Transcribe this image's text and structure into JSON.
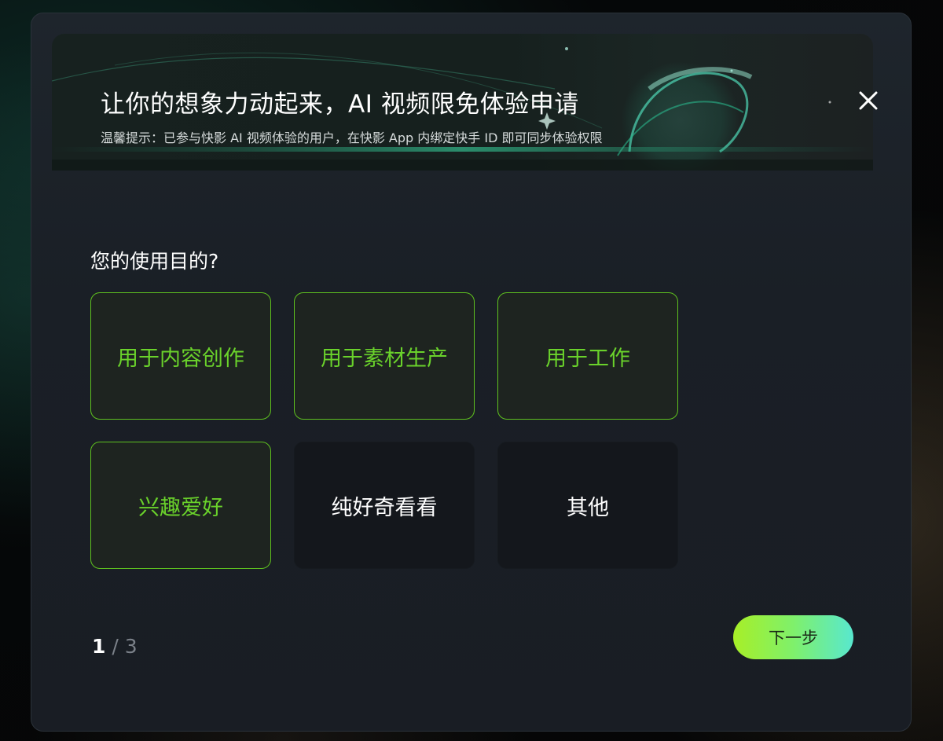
{
  "banner": {
    "title": "让你的想象力动起来，AI 视频限免体验申请",
    "tip": "温馨提示：已参与快影 AI 视频体验的用户，在快影 App 内绑定快手 ID 即可同步体验权限"
  },
  "question": "您的使用目的?",
  "options": [
    {
      "label": "用于内容创作",
      "selected": true
    },
    {
      "label": "用于素材生产",
      "selected": true
    },
    {
      "label": "用于工作",
      "selected": true
    },
    {
      "label": "兴趣爱好",
      "selected": true
    },
    {
      "label": "纯好奇看看",
      "selected": false
    },
    {
      "label": "其他",
      "selected": false
    }
  ],
  "pager": {
    "current": "1",
    "separator": "/",
    "total": "3"
  },
  "next_label": "下一步",
  "colors": {
    "accent": "#6ad22b",
    "button_gradient_start": "#a7ef27",
    "button_gradient_end": "#58e8cf"
  }
}
